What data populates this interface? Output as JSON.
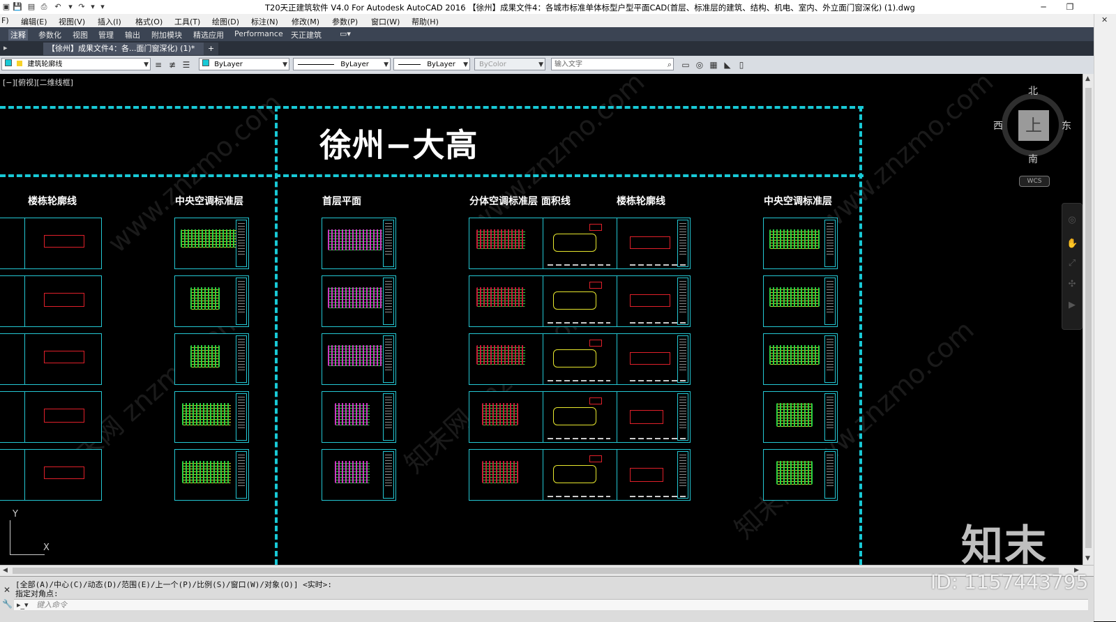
{
  "window": {
    "title": "T20天正建筑软件 V4.0 For Autodesk AutoCAD 2016    【徐州】成果文件4：各城市标准单体标型户型平面CAD(首层、标准层的建筑、结构、机电、室内、外立面门窗深化) (1).dwg",
    "minimize": "─",
    "restore": "❐"
  },
  "quick_access": [
    "save-icon",
    "saveas-icon",
    "print-icon",
    "undo-icon",
    "redo-icon",
    "dropdown-icon"
  ],
  "menu": [
    "编辑(E)",
    "视图(V)",
    "插入(I)",
    "格式(O)",
    "工具(T)",
    "绘图(D)",
    "标注(N)",
    "修改(M)",
    "参数(P)",
    "窗口(W)",
    "帮助(H)"
  ],
  "menu_left_stub": "F)",
  "ribbon_tabs": [
    {
      "label": "注释",
      "active": true
    },
    {
      "label": "参数化",
      "active": false
    },
    {
      "label": "视图",
      "active": false
    },
    {
      "label": "管理",
      "active": false
    },
    {
      "label": "输出",
      "active": false
    },
    {
      "label": "附加模块",
      "active": false
    },
    {
      "label": "精选应用",
      "active": false
    },
    {
      "label": "Performance",
      "active": false
    },
    {
      "label": "天正建筑",
      "active": false
    }
  ],
  "file_tab": {
    "label": "【徐州】成果文件4：各...面门窗深化) (1)*",
    "close": "✕",
    "new_tab": "+"
  },
  "toolbar": {
    "layer": "建筑轮廓线",
    "color": "ByLayer",
    "linetype": "ByLayer",
    "lineweight": "ByLayer",
    "plotstyle": "ByColor",
    "search_placeholder": "输入文字"
  },
  "canvas": {
    "view_label": "[−][俯视][二维线框]",
    "main_title": "徐州−大高",
    "column_headers": [
      "楼栋轮廓线",
      "中央空调标准层",
      "首层平面",
      "分体空调标准层 面积线",
      "楼栋轮廓线",
      "中央空调标准层"
    ]
  },
  "compass": {
    "north": "北",
    "south": "南",
    "east": "东",
    "west": "西",
    "top": "上",
    "wcs": "WCS"
  },
  "ucs": {
    "x": "X",
    "y": "Y"
  },
  "logo_text": "知末",
  "id_text": "ID: 1157443795",
  "command": {
    "line1": "[全部(A)/中心(C)/动态(D)/范围(E)/上一个(P)/比例(S)/窗口(W)/对象(O)] <实时>:",
    "line2": "指定对角点:",
    "input_placeholder": "键入命令"
  },
  "colors": {
    "dashed_frame": "#18c9d6",
    "sheet_border": "#24c8d4",
    "outline_red": "#e0202a",
    "plan_green": "#2ee84a",
    "plan_magenta": "#e040d8"
  }
}
